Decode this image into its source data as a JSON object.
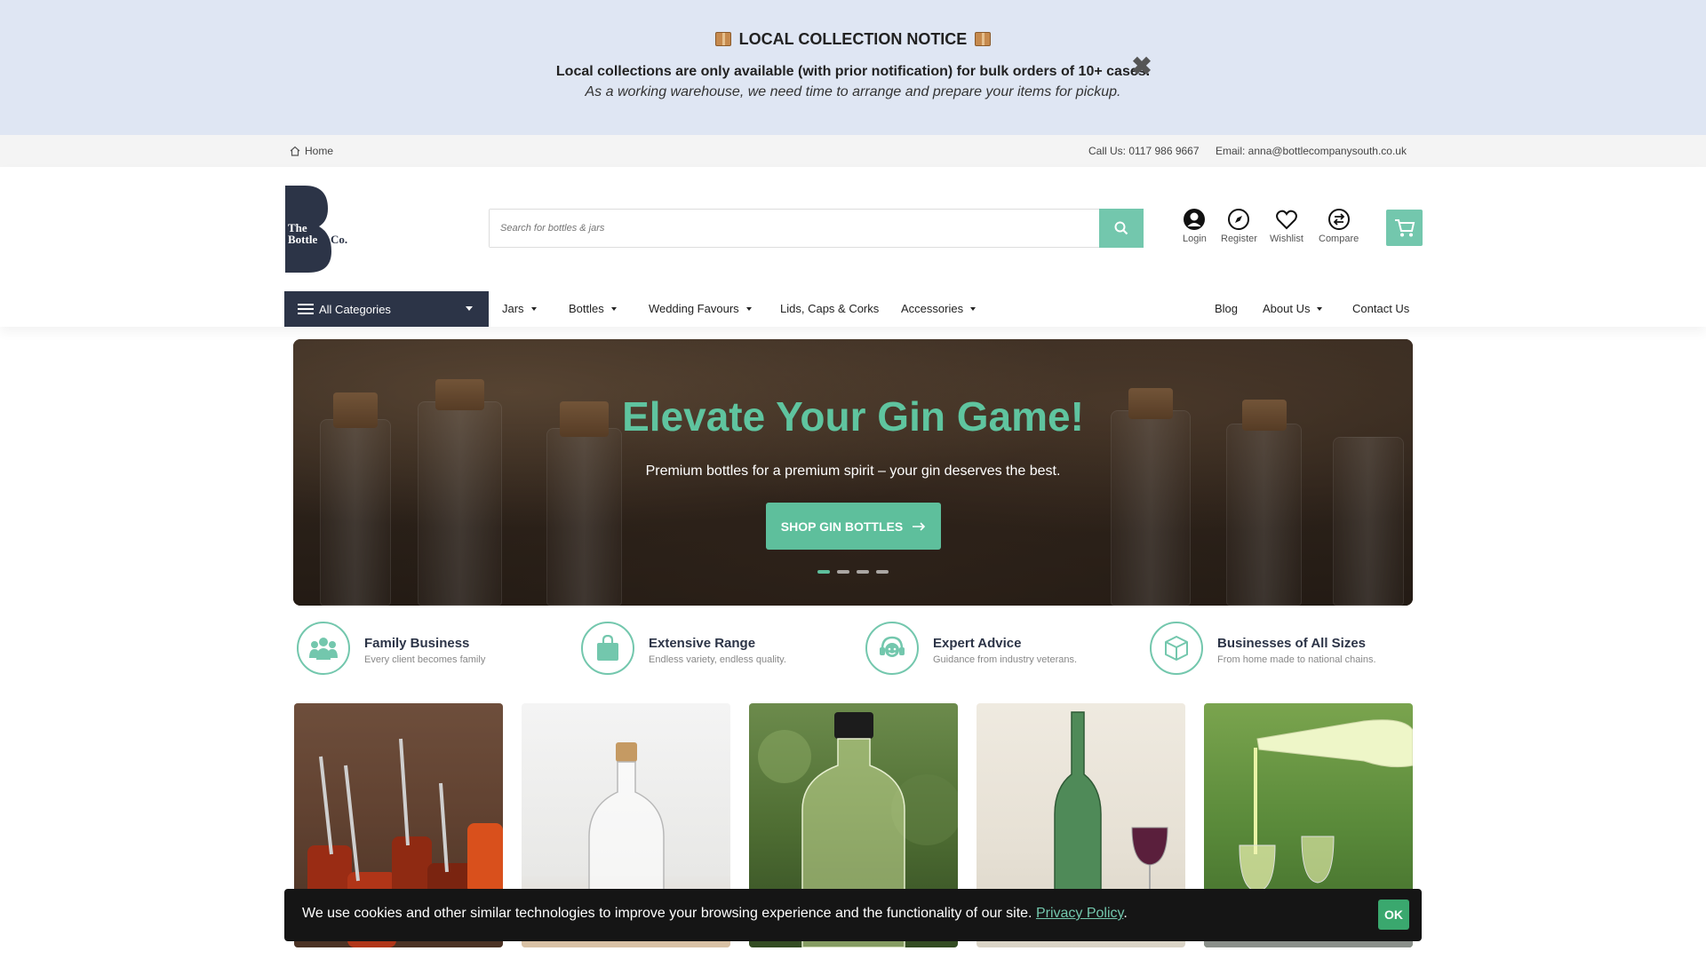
{
  "notice": {
    "title": "LOCAL COLLECTION NOTICE",
    "line1": "Local collections are only available (with prior notification) for bulk orders of 10+ cases.",
    "line2": "As a working warehouse, we need time to arrange and prepare your items for pickup.",
    "close_glyph": "✖"
  },
  "topbar": {
    "home_label": "Home",
    "call": "Call Us: 0117 986 9667",
    "email": "Email: anna@bottlecompanysouth.co.uk"
  },
  "header": {
    "logo_line1": "The",
    "logo_line2": "Bottle",
    "logo_line3": "Co.",
    "search_placeholder": "Search for bottles & jars",
    "account": {
      "login": "Login",
      "register": "Register",
      "wishlist": "Wishlist",
      "compare": "Compare"
    }
  },
  "nav": {
    "all_categories": "All Categories",
    "items": [
      "Jars",
      "Bottles",
      "Wedding Favours",
      "Lids, Caps & Corks",
      "Accessories"
    ],
    "right_items": [
      "Blog",
      "About Us",
      "Contact Us"
    ]
  },
  "hero": {
    "title": "Elevate Your Gin Game!",
    "subtitle": "Premium bottles for a premium spirit – your gin deserves the best.",
    "button": "SHOP GIN BOTTLES",
    "slide_count": 4,
    "active_slide": 1
  },
  "features": [
    {
      "title": "Family Business",
      "subtitle": "Every client becomes family",
      "icon": "people-icon"
    },
    {
      "title": "Extensive Range",
      "subtitle": "Endless variety, endless quality.",
      "icon": "shopping-bag-icon"
    },
    {
      "title": "Expert Advice",
      "subtitle": "Guidance from industry veterans.",
      "icon": "support-agent-icon"
    },
    {
      "title": "Businesses of All Sizes",
      "subtitle": "From home made to national chains.",
      "icon": "box-icon"
    }
  ],
  "cookie": {
    "text": "We use cookies and other similar technologies to improve your browsing experience and the functionality of our site.",
    "link": "Privacy Policy",
    "after": ".",
    "ok": "OK"
  },
  "colors": {
    "accent": "#73c7ad",
    "dark": "#2c3447",
    "notice_bg": "#dfe6f3"
  }
}
